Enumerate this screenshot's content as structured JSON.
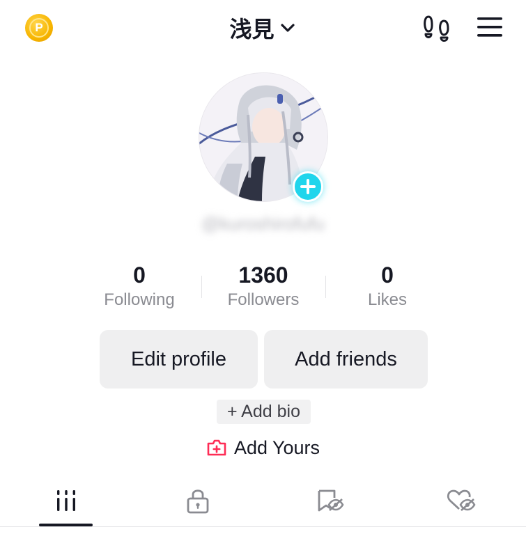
{
  "header": {
    "coin_letter": "P",
    "title": "浅見",
    "icons": [
      "coin-icon",
      "chevron-down-icon",
      "footprints-icon",
      "menu-icon"
    ]
  },
  "profile": {
    "username": "@kuroshirofufu"
  },
  "stats": [
    {
      "value": "0",
      "label": "Following"
    },
    {
      "value": "1360",
      "label": "Followers"
    },
    {
      "value": "0",
      "label": "Likes"
    }
  ],
  "actions": {
    "edit_profile": "Edit profile",
    "add_friends": "Add friends",
    "add_bio": "+ Add bio",
    "add_yours": "Add Yours"
  },
  "tabs": [
    {
      "icon": "videos-grid-icon",
      "active": true
    },
    {
      "icon": "lock-icon",
      "active": false
    },
    {
      "icon": "hidden-bookmark-icon",
      "active": false
    },
    {
      "icon": "hidden-liked-icon",
      "active": false
    }
  ],
  "colors": {
    "accent_cyan": "#20d5ec",
    "coin_gold": "#f7b500",
    "add_yours_red": "#fe2c55",
    "button_bg": "#efeff0",
    "text": "#161823",
    "muted": "#8a8b91"
  }
}
